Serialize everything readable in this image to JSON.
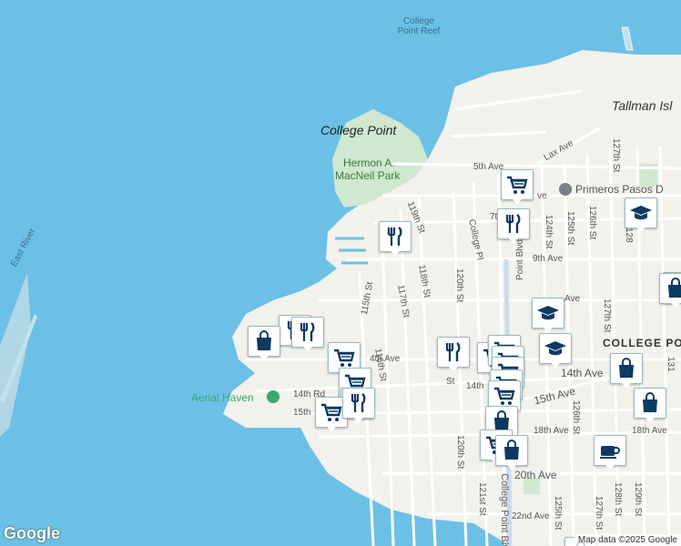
{
  "map": {
    "water_labels": {
      "east_river": "East River",
      "reef": "College\nPoint Reef",
      "tallman": "Tallman Isl"
    },
    "place_labels": {
      "college_point": "College Point",
      "park_line1": "Hermon A.",
      "park_line2": "MacNeil Park",
      "college_point_caps": "COLLEGE POI"
    },
    "poi_labels": {
      "primeros": "Primeros Pasos D",
      "aerial_haven": "Aerial Haven"
    },
    "streets": {
      "lax_ave": "Lax Ave",
      "fifth_ave": "5th Ave",
      "sixth_ave": "ve",
      "seventh_ave": "7t",
      "ninth_ave": "9th Ave",
      "tenth_ave": "Ave",
      "fourteenth_ave": "14th Ave",
      "fourteenth_ave_left": "4th Ave",
      "fourteenth_rd": "14th Rd",
      "fourteenth_st_short": "14th",
      "fifteenth_ave": "15th Ave",
      "fifteenth_ave_left": "15th",
      "eighteenth_ave": "18th Ave",
      "eighteenth_ave_right": "18th Ave",
      "twentieth_ave": "20th Ave",
      "twenty_second_ave": "22nd Ave",
      "s115": "115th St",
      "s116": "116th St",
      "s117": "117th St",
      "s118": "118th St",
      "s119": "119th St",
      "s120": "120th St",
      "s120b": "120th St",
      "s121": "121st St",
      "s124": "124th St",
      "s125": "125th St",
      "s126": "126th St",
      "s127": "127th St",
      "s124b": "124th St",
      "s125b": "125th St",
      "s126b": "126th St",
      "s127b": "127th St",
      "s128": "128th St",
      "s129": "129th St",
      "s12x": "12",
      "s128top": "128",
      "s12b": "12",
      "s13": "13",
      "s131": "131",
      "college_pl": "College Pl",
      "college_pt_blvd": "College Point Blvd",
      "point_blvd": "Point Blvd",
      "st_frag": "St",
      "sixth_s": "6"
    },
    "attribution": "Map data ©2025 Google",
    "logo": "Google"
  },
  "pins": [
    {
      "icon": "cart"
    },
    {
      "icon": "fork"
    },
    {
      "icon": "fork"
    },
    {
      "icon": "grad"
    },
    {
      "icon": "bag"
    },
    {
      "icon": "grad"
    },
    {
      "icon": "fork"
    },
    {
      "icon": "bag"
    },
    {
      "icon": "fork"
    },
    {
      "icon": "cart"
    },
    {
      "icon": "cart"
    },
    {
      "icon": "cart"
    },
    {
      "icon": "cart"
    },
    {
      "icon": "fork"
    },
    {
      "icon": "fork"
    },
    {
      "icon": "cart"
    },
    {
      "icon": "cart"
    },
    {
      "icon": "cart"
    },
    {
      "icon": "cart"
    },
    {
      "icon": "cart"
    },
    {
      "icon": "cart"
    },
    {
      "icon": "bag"
    },
    {
      "icon": "cart"
    },
    {
      "icon": "bag"
    },
    {
      "icon": "bag"
    },
    {
      "icon": "bag"
    },
    {
      "icon": "grad"
    },
    {
      "icon": "bag"
    },
    {
      "icon": "coffee"
    },
    {
      "icon": "bag"
    }
  ],
  "colors": {
    "water": "#6cc0e5",
    "land": "#f2f1ec",
    "park": "#cfe8cf",
    "road": "#ffffff",
    "pin_icon": "#0c3a61"
  }
}
